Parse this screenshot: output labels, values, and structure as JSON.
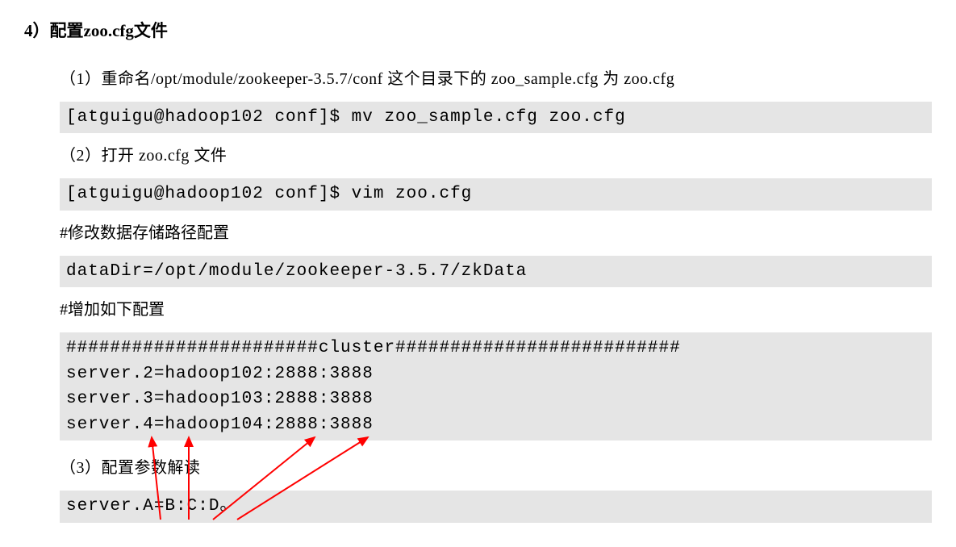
{
  "heading": "4）配置zoo.cfg文件",
  "step1": {
    "label": "（1）重命名/opt/module/zookeeper-3.5.7/conf 这个目录下的 zoo_sample.cfg 为 zoo.cfg",
    "command": "[atguigu@hadoop102 conf]$ mv zoo_sample.cfg zoo.cfg"
  },
  "step2": {
    "label": "（2）打开 zoo.cfg 文件",
    "command": "[atguigu@hadoop102 conf]$ vim zoo.cfg"
  },
  "comment1": "#修改数据存储路径配置",
  "datadir": "dataDir=/opt/module/zookeeper-3.5.7/zkData",
  "comment2": "#增加如下配置",
  "cluster_config": "#######################cluster##########################\nserver.2=hadoop102:2888:3888\nserver.3=hadoop103:2888:3888\nserver.4=hadoop104:2888:3888",
  "step3": {
    "label": "（3）配置参数解读",
    "format": "server.A=B:C:D。"
  }
}
